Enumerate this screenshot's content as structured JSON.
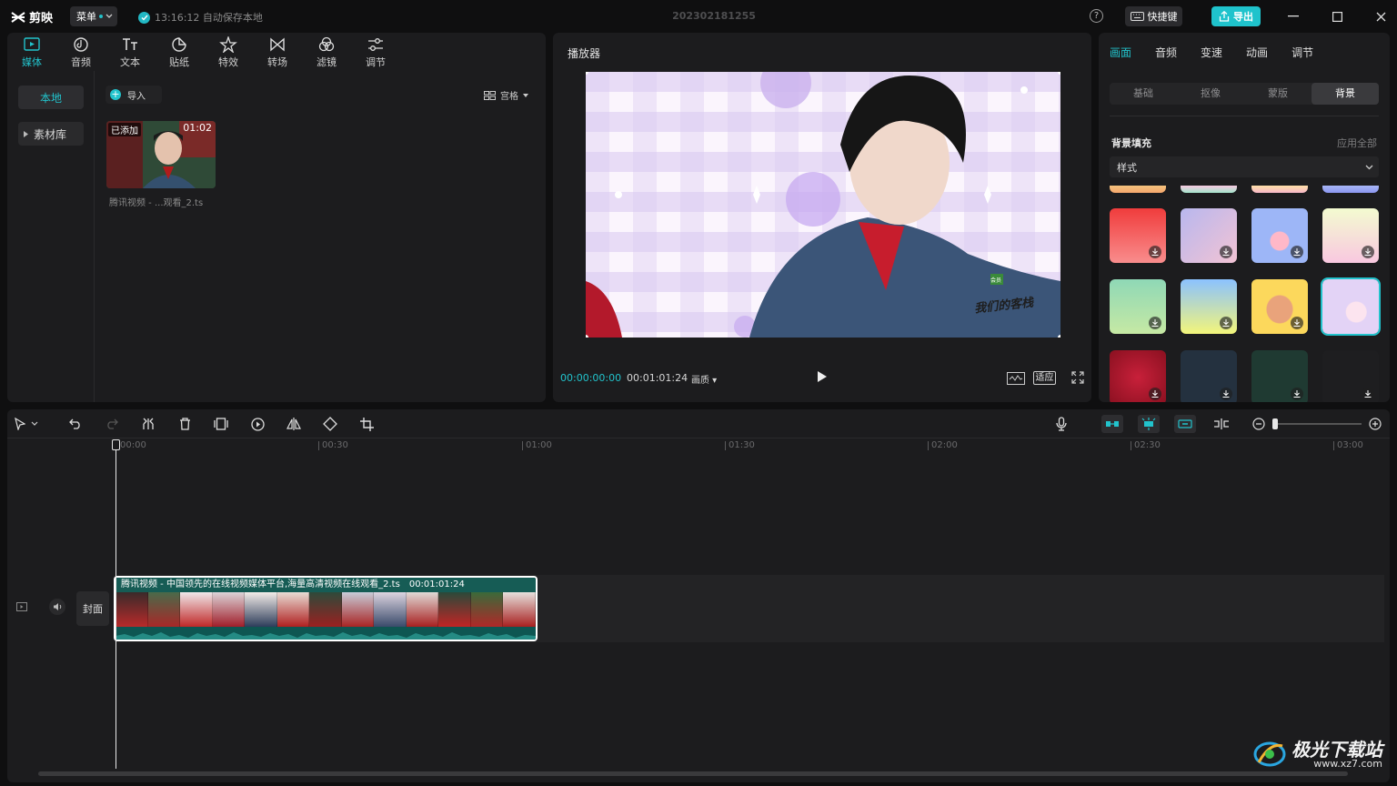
{
  "titlebar": {
    "app_name": "剪映",
    "menu_label": "菜单",
    "autosave_text": "13:16:12 自动保存本地",
    "project_name": "202302181255",
    "help_label": "?",
    "shortcut_label": "快捷键",
    "export_label": "导出"
  },
  "media": {
    "tabs": [
      {
        "label": "媒体",
        "icon": "media-icon"
      },
      {
        "label": "音频",
        "icon": "audio-icon"
      },
      {
        "label": "文本",
        "icon": "text-icon"
      },
      {
        "label": "贴纸",
        "icon": "sticker-icon"
      },
      {
        "label": "特效",
        "icon": "effects-icon"
      },
      {
        "label": "转场",
        "icon": "transition-icon"
      },
      {
        "label": "滤镜",
        "icon": "filter-icon"
      },
      {
        "label": "调节",
        "icon": "adjust-icon"
      }
    ],
    "side_local": "本地",
    "side_library": "素材库",
    "import_label": "导入",
    "view_label": "宫格",
    "thumb_added": "已添加",
    "thumb_duration": "01:02",
    "thumb_name": "腾讯视频 - ...观看_2.ts"
  },
  "player": {
    "title": "播放器",
    "current_time": "00:00:00:00",
    "total_time": "00:01:01:24",
    "quality_label": "画质",
    "fit_label": "适应",
    "video_overlay_text": "我们的客栈",
    "video_badge": "会员"
  },
  "props": {
    "tabs": [
      "画面",
      "音频",
      "变速",
      "动画",
      "调节"
    ],
    "subtabs": [
      "基础",
      "抠像",
      "蒙版",
      "背景"
    ],
    "bg_fill_label": "背景填充",
    "apply_all_label": "应用全部",
    "style_label": "样式"
  },
  "timeline": {
    "ticks": [
      "00:00",
      "00:30",
      "01:00",
      "01:30",
      "02:00",
      "02:30",
      "03:00"
    ],
    "clip_title": "腾讯视频 - 中国领先的在线视频媒体平台,海量高清视频在线观看_2.ts",
    "clip_duration": "00:01:01:24",
    "cover_label": "封面"
  },
  "watermark": {
    "title": "极光下载站",
    "url": "www.xz7.com"
  },
  "colors": {
    "accent": "#22c3cc",
    "panel": "#1c1c1e",
    "background": "#0f0f10"
  }
}
